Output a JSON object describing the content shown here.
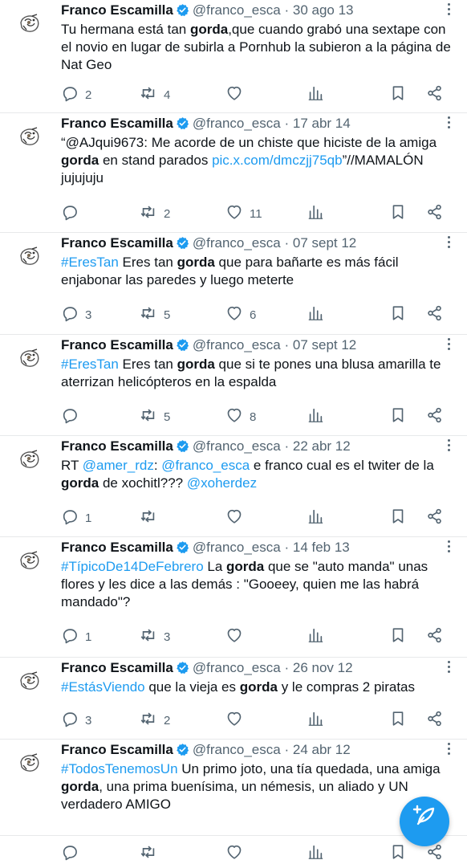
{
  "account": {
    "name": "Franco Escamilla",
    "handle": "@franco_esca",
    "separator": "·"
  },
  "icons": {
    "verified": "verified-badge-icon",
    "more": "more-options-icon",
    "reply": "reply-icon",
    "retweet": "retweet-icon",
    "like": "like-icon",
    "views": "views-icon",
    "bookmark": "bookmark-icon",
    "share": "share-icon",
    "compose": "compose-icon"
  },
  "colors": {
    "accent": "#1d9bf0",
    "text": "#0f1419",
    "muted": "#536471",
    "divider": "#e7e9ea"
  },
  "tweets": [
    {
      "date": "30 ago 13",
      "segments": [
        {
          "t": "Tu hermana está tan ",
          "s": "n"
        },
        {
          "t": "gorda",
          "s": "b"
        },
        {
          "t": ",que cuando grabó una sextape con el novio en lugar de subirla a Pornhub la subieron a la página de Nat Geo",
          "s": "n"
        }
      ],
      "replies": "2",
      "retweets": "4",
      "likes": ""
    },
    {
      "date": "17 abr 14",
      "segments": [
        {
          "t": "“@AJqui9673: Me acorde de un chiste que hiciste de la amiga ",
          "s": "n"
        },
        {
          "t": "gorda",
          "s": "b"
        },
        {
          "t": " en stand parados ",
          "s": "n"
        },
        {
          "t": "pic.x.com/dmczjj75qb",
          "s": "l"
        },
        {
          "t": "”//MAMALÓN jujujuju",
          "s": "n"
        }
      ],
      "replies": "",
      "retweets": "2",
      "likes": "11"
    },
    {
      "date": "07 sept 12",
      "segments": [
        {
          "t": "#EresTan",
          "s": "l"
        },
        {
          "t": "  Eres tan ",
          "s": "n"
        },
        {
          "t": "gorda",
          "s": "b"
        },
        {
          "t": " que para bañarte es más fácil enjabonar las paredes y luego meterte",
          "s": "n"
        }
      ],
      "replies": "3",
      "retweets": "5",
      "likes": "6"
    },
    {
      "date": "07 sept 12",
      "segments": [
        {
          "t": "#EresTan",
          "s": "l"
        },
        {
          "t": "   Eres tan ",
          "s": "n"
        },
        {
          "t": "gorda",
          "s": "b"
        },
        {
          "t": " que si te pones una blusa amarilla te aterrizan helicópteros en la espalda",
          "s": "n"
        }
      ],
      "replies": "",
      "retweets": "5",
      "likes": "8"
    },
    {
      "date": "22 abr 12",
      "segments": [
        {
          "t": "RT ",
          "s": "n"
        },
        {
          "t": "@amer_rdz",
          "s": "l"
        },
        {
          "t": ": ",
          "s": "n"
        },
        {
          "t": "@franco_esca",
          "s": "l"
        },
        {
          "t": "  e franco cual es el twiter de la ",
          "s": "n"
        },
        {
          "t": "gorda",
          "s": "b"
        },
        {
          "t": " de xochitl??? ",
          "s": "n"
        },
        {
          "t": "@xoherdez",
          "s": "l"
        }
      ],
      "replies": "1",
      "retweets": "",
      "likes": ""
    },
    {
      "date": "14 feb 13",
      "segments": [
        {
          "t": "#TípicoDe14DeFebrero",
          "s": "l"
        },
        {
          "t": "  La ",
          "s": "n"
        },
        {
          "t": "gorda",
          "s": "b"
        },
        {
          "t": " que se \"auto manda\" unas flores y les dice a las demás : \"Gooeey, quien me las habrá mandado\"?",
          "s": "n"
        }
      ],
      "replies": "1",
      "retweets": "3",
      "likes": ""
    },
    {
      "date": "26 nov 12",
      "segments": [
        {
          "t": "#EstásViendo",
          "s": "l"
        },
        {
          "t": "  que la vieja es ",
          "s": "n"
        },
        {
          "t": "gorda",
          "s": "b"
        },
        {
          "t": " y le compras 2 piratas",
          "s": "n"
        }
      ],
      "replies": "3",
      "retweets": "2",
      "likes": ""
    },
    {
      "date": "24 abr 12",
      "segments": [
        {
          "t": "#TodosTenemosUn",
          "s": "l"
        },
        {
          "t": "  Un primo joto, una tía quedada, una amiga ",
          "s": "n"
        },
        {
          "t": "gorda",
          "s": "b"
        },
        {
          "t": ", una prima buenísima, un némesis, un aliad",
          "s": "n"
        },
        {
          "t": "o y UN",
          "s": "n"
        },
        {
          "t": " verdadero AMIGO",
          "s": "n"
        }
      ],
      "replies": "",
      "retweets": "",
      "likes": ""
    }
  ]
}
